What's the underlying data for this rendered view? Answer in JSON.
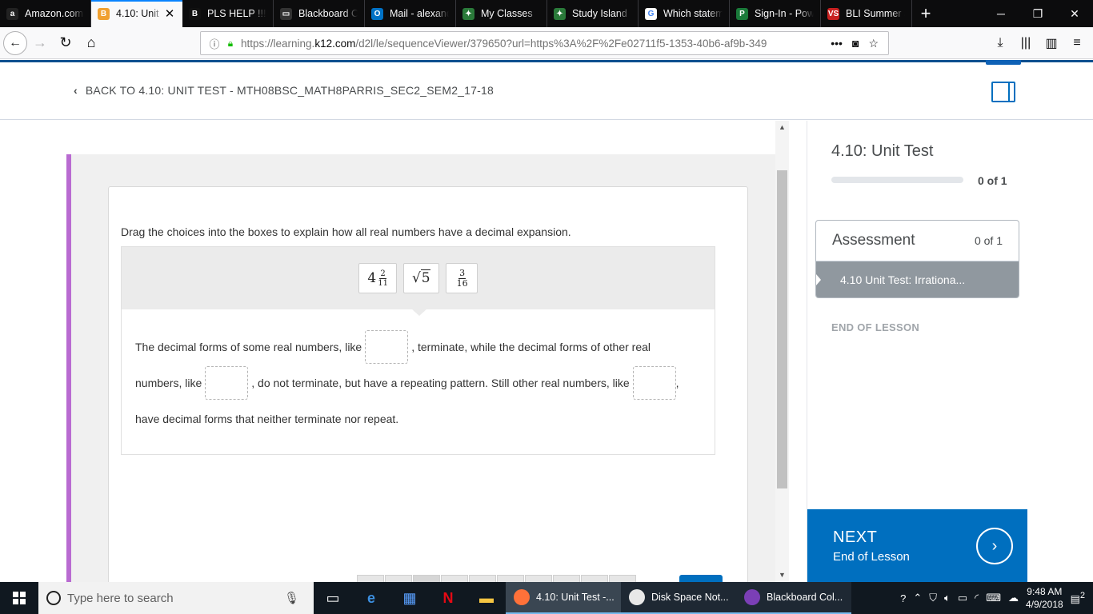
{
  "browser": {
    "tabs": [
      {
        "label": "Amazon.com",
        "fav": "a",
        "color": "#222"
      },
      {
        "label": "4.10: Unit",
        "fav": "B",
        "color": "#f0a030",
        "active": true
      },
      {
        "label": "PLS HELP !!!!!!",
        "fav": "B",
        "color": "#111"
      },
      {
        "label": "Blackboard C",
        "fav": "▭",
        "color": "#333"
      },
      {
        "label": "Mail - alexand",
        "fav": "O",
        "color": "#0072c6"
      },
      {
        "label": "My Classes",
        "fav": "✦",
        "color": "#2a7a3a"
      },
      {
        "label": "Study Island",
        "fav": "✦",
        "color": "#2a7a3a"
      },
      {
        "label": "Which statem",
        "fav": "G",
        "color": "#fff"
      },
      {
        "label": "Sign-In - Pow",
        "fav": "P",
        "color": "#1a7a3a"
      },
      {
        "label": "BLI Summer J",
        "fav": "VS",
        "color": "#c82020"
      }
    ],
    "tab_close": "✕",
    "new_tab": "+",
    "url_host_prefix": "https://learning.",
    "url_host": "k12.com",
    "url_path": "/d2l/le/sequenceViewer/379650?url=https%3A%2F%2Fe02711f5-1353-40b6-af9b-349",
    "url_more": "•••",
    "window_controls": [
      "─",
      "❐",
      "✕"
    ]
  },
  "header": {
    "back_chevron": "‹",
    "back_label": "BACK TO 4.10: UNIT TEST - MTH08BSC_MATH8PARRIS_SEC2_SEM2_17-18"
  },
  "question": {
    "prompt": "Drag the choices into the boxes to explain how all real numbers have a decimal expansion.",
    "choices": {
      "mixed_whole": "4",
      "mixed_num": "2",
      "mixed_den": "11",
      "sqrt_sym": "√",
      "sqrt_val": "5",
      "frac_num": "3",
      "frac_den": "16"
    },
    "line1_a": "The decimal forms of some real numbers, like",
    "line1_b": ", terminate, while the decimal forms of other real",
    "line2_a": "numbers, like",
    "line2_b": ", do not terminate, but have a repeating pattern. Still other real numbers, like",
    "line2_c": ",",
    "line3": "have decimal forms that neither terminate nor repeat."
  },
  "sidebar": {
    "unit_title": "4.10: Unit Test",
    "progress_text": "0 of 1",
    "progress_fraction": 0,
    "assessment_title": "Assessment",
    "assessment_count": "0 of 1",
    "assessment_item": "4.10 Unit Test: Irrationa...",
    "end_of_lesson": "END OF LESSON",
    "next_label": "NEXT",
    "next_sub": "End of Lesson",
    "next_icon": "›"
  },
  "taskbar": {
    "search_placeholder": "Type here to search",
    "apps": [
      {
        "label": "4.10: Unit Test -...",
        "color": "#ff7139",
        "active": true
      },
      {
        "label": "Disk Space Not...",
        "color": "#e8e8e8"
      },
      {
        "label": "Blackboard Col...",
        "color": "#7b3fb6"
      }
    ],
    "time": "9:48 AM",
    "date": "4/9/2018",
    "notifications": "2"
  }
}
